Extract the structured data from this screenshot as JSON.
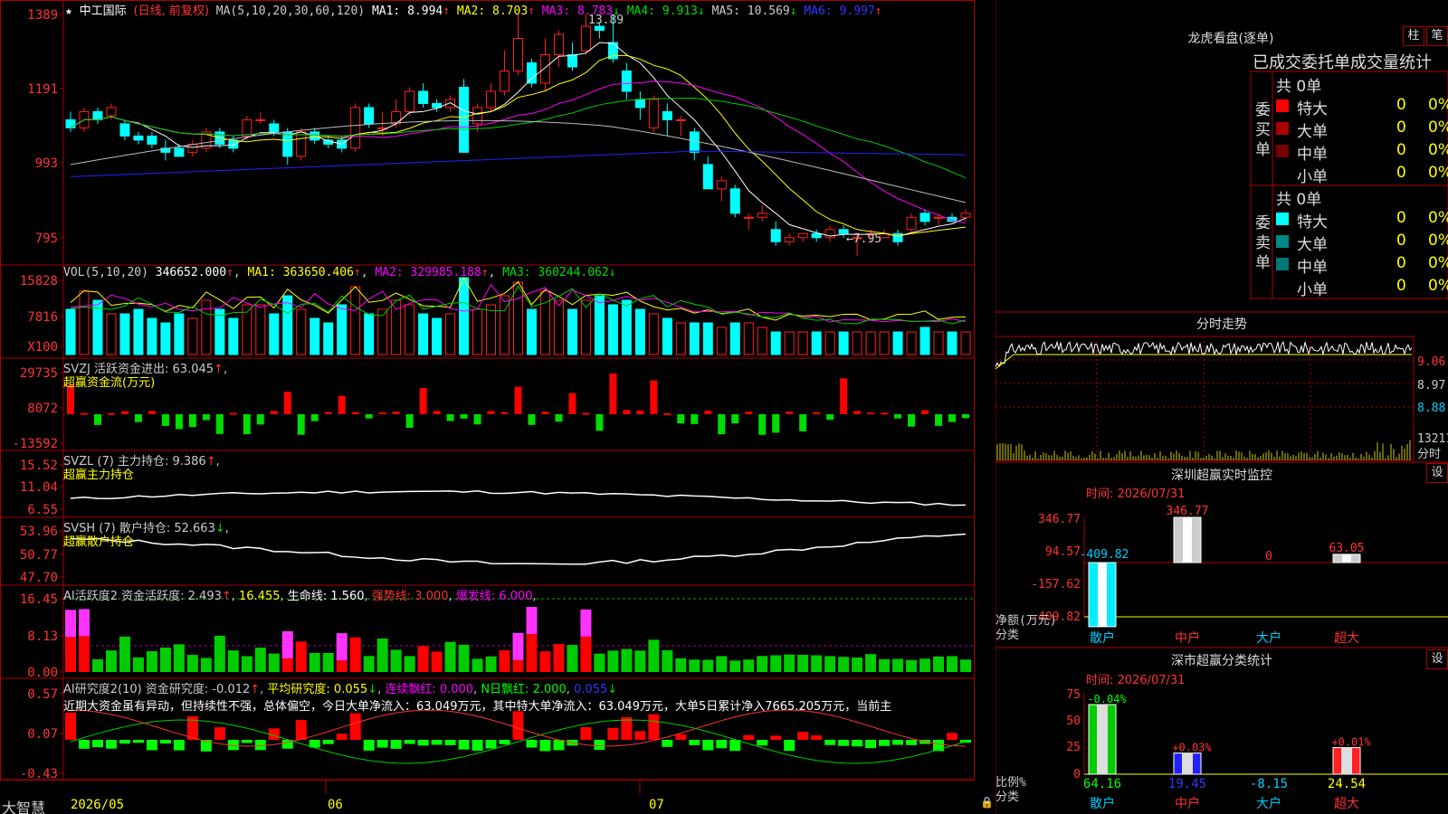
{
  "main": {
    "stock_name": "中工国际",
    "mode": "(日线, 前复权)",
    "ma_header": "MA(5,10,20,30,60,120)",
    "ma_values": [
      {
        "label": "MA1: 8.994",
        "color": "#ffffff"
      },
      {
        "label": "MA2: 8.703",
        "color": "#ffff00"
      },
      {
        "label": "MA3: 8.783",
        "color": "#ff00ff"
      },
      {
        "label": "MA4: 9.913",
        "color": "#00dd00"
      },
      {
        "label": "MA5: 10.569",
        "color": "#cccccc"
      },
      {
        "label": "MA6: 9.997",
        "color": "#3333ff"
      }
    ],
    "y_ticks": [
      "1389",
      "1191",
      "993",
      "795"
    ],
    "high_note": "13.89",
    "low_note": "←7.95"
  },
  "vol": {
    "header": "VOL(5,10,20)",
    "value": "346652.000",
    "ma": [
      "MA1: 363650.406",
      "MA2: 329985.188",
      "MA3: 360244.062"
    ],
    "y_ticks": [
      "15828",
      "7816",
      "X100"
    ]
  },
  "svzj": {
    "header": "SVZJ  活跃资金进出: 63.045",
    "subtitle": "超赢资金流(万元)",
    "y_ticks": [
      "29735",
      "8072",
      "-13592"
    ]
  },
  "svzl": {
    "header": "SVZL (7) 主力持仓: 9.386",
    "subtitle": "超赢主力持仓",
    "y_ticks": [
      "15.52",
      "11.04",
      "6.55"
    ]
  },
  "svsh": {
    "header": "SVSH (7) 散户持仓: 52.663",
    "subtitle": "超赢散户持仓",
    "y_ticks": [
      "53.96",
      "50.77",
      "47.70"
    ]
  },
  "ai1": {
    "header_a": "AI活跃度2 资金活跃度: 2.493",
    "header_b": "16.455",
    "header_c": "生命线: 1.560",
    "header_d": "强势线: 3.000",
    "header_e": "爆发线: 6.000",
    "y_ticks": [
      "16.45",
      "8.13",
      "0.00"
    ]
  },
  "ai2": {
    "header_a": "AI研究度2(10) 资金研究度: -0.012",
    "header_b": "平均研究度: 0.055",
    "header_c": "连续飘红: 0.000",
    "header_d": "N日飘红: 2.000",
    "header_e": "0.055",
    "comment": "近期大资金虽有异动，但持续性不强，总体偏空，今日大单净流入：63.049万元，其中特大单净流入：63.049万元，大单5日累计净入7665.205万元，当前主",
    "y_ticks": [
      "0.57",
      "0.07",
      "-0.43"
    ]
  },
  "footer": {
    "logo": "大智慧",
    "dates": [
      "2026/05",
      "06",
      "07"
    ]
  },
  "right": {
    "dragon_title": "龙虎看盘(逐单)",
    "btn_col": "柱",
    "btn_pen": "笔",
    "tab_header": "已成交委托单成交量统计",
    "buy": {
      "side_label": "委买单",
      "total": "共 0单",
      "rows": [
        {
          "label": "特大",
          "value": "0",
          "pct": "0%",
          "color": "#ff0000"
        },
        {
          "label": "大单",
          "value": "0",
          "pct": "0%",
          "color": "#aa0000"
        },
        {
          "label": "中单",
          "value": "0",
          "pct": "0%",
          "color": "#770000"
        },
        {
          "label": "小单",
          "value": "0",
          "pct": "0%",
          "color": "#000000"
        }
      ]
    },
    "sell": {
      "side_label": "委卖单",
      "total": "共 0单",
      "rows": [
        {
          "label": "特大",
          "value": "0",
          "pct": "0%",
          "color": "#00ffff"
        },
        {
          "label": "大单",
          "value": "0",
          "pct": "0%",
          "color": "#008888"
        },
        {
          "label": "中单",
          "value": "0",
          "pct": "0%",
          "color": "#007777"
        },
        {
          "label": "小单",
          "value": "0",
          "pct": "0%",
          "color": "#000000"
        }
      ]
    },
    "intraday_title": "分时走势",
    "intraday_ticks": [
      "9.06",
      "8.97",
      "8.88"
    ],
    "intraday_vol": "13211",
    "intraday_vol_unit": "分时",
    "sz_title": "深圳超赢实时监控",
    "sz_btn": "设",
    "sz_time": "时间: 2026/07/31",
    "sz_ticks": [
      "346.77",
      "94.57",
      "-157.62",
      "-409.82"
    ],
    "sz_axis_label1": "净额(万元)",
    "sz_axis_label2": "分类",
    "sz_bars": [
      {
        "cat": "散户",
        "value": -409.82,
        "label": "-409.82"
      },
      {
        "cat": "中户",
        "value": 346.77,
        "label": "346.77"
      },
      {
        "cat": "大户",
        "value": 0,
        "label": "0"
      },
      {
        "cat": "超大",
        "value": 63.05,
        "label": "63.05"
      }
    ],
    "sc_title": "深市超赢分类统计",
    "sc_btn": "设",
    "sc_time": "时间: 2026/07/31",
    "sc_ticks": [
      "75",
      "50",
      "25",
      "0"
    ],
    "sc_axis_label1": "比例%",
    "sc_axis_label2": "分类",
    "sc_bars": [
      {
        "cat": "散户",
        "value": 64.16,
        "label": "64.16",
        "top": "-0.04%"
      },
      {
        "cat": "中户",
        "value": 19.45,
        "label": "19.45",
        "top": "+0.03%"
      },
      {
        "cat": "大户",
        "value": -8.15,
        "label": "-8.15",
        "top": ""
      },
      {
        "cat": "超大",
        "value": 24.54,
        "label": "24.54",
        "top": "+0.01%"
      }
    ]
  },
  "chart_data": [
    {
      "type": "candlestick",
      "title": "中工国际 (日线, 前复权)",
      "ylim": [
        7.6,
        14.2
      ],
      "x": [
        "2026/05",
        "06",
        "07"
      ],
      "candles": [
        [
          11.3,
          11.1,
          11.5,
          11.0
        ],
        [
          11.1,
          11.5,
          11.6,
          11.0
        ],
        [
          11.5,
          11.3,
          11.6,
          11.2
        ],
        [
          11.4,
          11.6,
          11.7,
          11.3
        ],
        [
          11.2,
          10.9,
          11.3,
          10.8
        ],
        [
          10.9,
          10.8,
          11.0,
          10.7
        ],
        [
          10.9,
          10.7,
          11.0,
          10.6
        ],
        [
          10.6,
          10.5,
          10.8,
          10.3
        ],
        [
          10.6,
          10.4,
          10.7,
          10.4
        ],
        [
          10.5,
          10.7,
          10.8,
          10.4
        ],
        [
          10.6,
          11.0,
          11.1,
          10.5
        ],
        [
          11.0,
          10.7,
          11.1,
          10.6
        ],
        [
          10.8,
          10.6,
          10.9,
          10.5
        ],
        [
          10.9,
          11.3,
          11.4,
          10.8
        ],
        [
          11.3,
          11.3,
          11.5,
          11.2
        ],
        [
          11.2,
          11.0,
          11.3,
          10.9
        ],
        [
          11.0,
          10.4,
          11.1,
          10.2
        ],
        [
          10.4,
          11.0,
          11.1,
          10.3
        ],
        [
          11.0,
          10.8,
          11.1,
          10.7
        ],
        [
          10.8,
          10.7,
          10.9,
          10.6
        ],
        [
          10.8,
          10.6,
          10.9,
          10.5
        ],
        [
          10.6,
          11.6,
          11.7,
          10.5
        ],
        [
          11.6,
          11.2,
          11.7,
          11.1
        ],
        [
          11.1,
          11.1,
          11.5,
          10.9
        ],
        [
          11.2,
          11.5,
          11.8,
          11.1
        ],
        [
          11.5,
          12.0,
          12.1,
          11.4
        ],
        [
          12.0,
          11.7,
          12.2,
          11.6
        ],
        [
          11.7,
          11.6,
          11.8,
          11.5
        ],
        [
          11.6,
          11.8,
          11.9,
          11.5
        ],
        [
          12.1,
          10.5,
          12.3,
          10.5
        ],
        [
          11.2,
          11.6,
          11.7,
          11.0
        ],
        [
          11.6,
          12.0,
          12.2,
          11.5
        ],
        [
          12.0,
          12.5,
          13.0,
          11.9
        ],
        [
          12.5,
          13.3,
          13.9,
          12.4
        ],
        [
          12.7,
          12.2,
          12.8,
          12.1
        ],
        [
          12.2,
          12.9,
          13.3,
          12.0
        ],
        [
          12.9,
          13.4,
          13.5,
          12.6
        ],
        [
          12.9,
          12.6,
          13.2,
          12.5
        ],
        [
          13.0,
          13.6,
          13.9,
          12.9
        ],
        [
          13.6,
          13.5,
          13.7,
          13.3
        ],
        [
          13.2,
          12.8,
          13.9,
          12.7
        ],
        [
          12.5,
          12.0,
          12.7,
          11.8
        ],
        [
          11.8,
          11.6,
          12.0,
          11.3
        ],
        [
          11.1,
          11.8,
          11.9,
          11.0
        ],
        [
          11.5,
          11.3,
          11.7,
          10.9
        ],
        [
          11.3,
          11.3,
          11.4,
          10.9
        ],
        [
          11.0,
          10.5,
          11.1,
          10.3
        ],
        [
          10.2,
          9.6,
          10.4,
          9.6
        ],
        [
          9.6,
          9.8,
          9.9,
          9.3
        ],
        [
          9.6,
          9.0,
          9.7,
          8.9
        ],
        [
          8.9,
          8.9,
          9.0,
          8.6
        ],
        [
          8.9,
          9.0,
          9.2,
          8.8
        ],
        [
          8.6,
          8.3,
          8.8,
          8.2
        ],
        [
          8.3,
          8.4,
          8.5,
          8.2
        ],
        [
          8.4,
          8.5,
          8.5,
          8.3
        ],
        [
          8.5,
          8.4,
          8.6,
          8.3
        ],
        [
          8.4,
          8.6,
          8.7,
          8.3
        ],
        [
          8.6,
          8.5,
          8.7,
          8.4
        ],
        [
          8.4,
          8.4,
          8.5,
          7.95
        ],
        [
          8.5,
          8.5,
          8.6,
          8.3
        ],
        [
          8.4,
          8.5,
          8.6,
          8.4
        ],
        [
          8.5,
          8.3,
          8.6,
          8.2
        ],
        [
          8.6,
          8.9,
          9.0,
          8.5
        ],
        [
          9.0,
          8.8,
          9.1,
          8.7
        ],
        [
          8.9,
          8.9,
          9.0,
          8.7
        ],
        [
          8.9,
          8.8,
          9.0,
          8.8
        ],
        [
          8.9,
          9.0,
          9.1,
          8.8
        ]
      ]
    },
    {
      "type": "bar",
      "title": "VOL(5,10,20)",
      "values": [
        10,
        14,
        12,
        9,
        9,
        10,
        8,
        7,
        9,
        8,
        12,
        10,
        8,
        11,
        11,
        9,
        13,
        10,
        8,
        7,
        11,
        15,
        9,
        10,
        12,
        11,
        9,
        8,
        9,
        17,
        10,
        11,
        13,
        16,
        10,
        14,
        12,
        10,
        12,
        13,
        11,
        12,
        10,
        9,
        8,
        7,
        7,
        7,
        6,
        7,
        7,
        6,
        5,
        5,
        5,
        5,
        5,
        5,
        5,
        5,
        5,
        5,
        5,
        6,
        5,
        5,
        5
      ],
      "ylim": [
        0,
        16
      ]
    }
  ]
}
